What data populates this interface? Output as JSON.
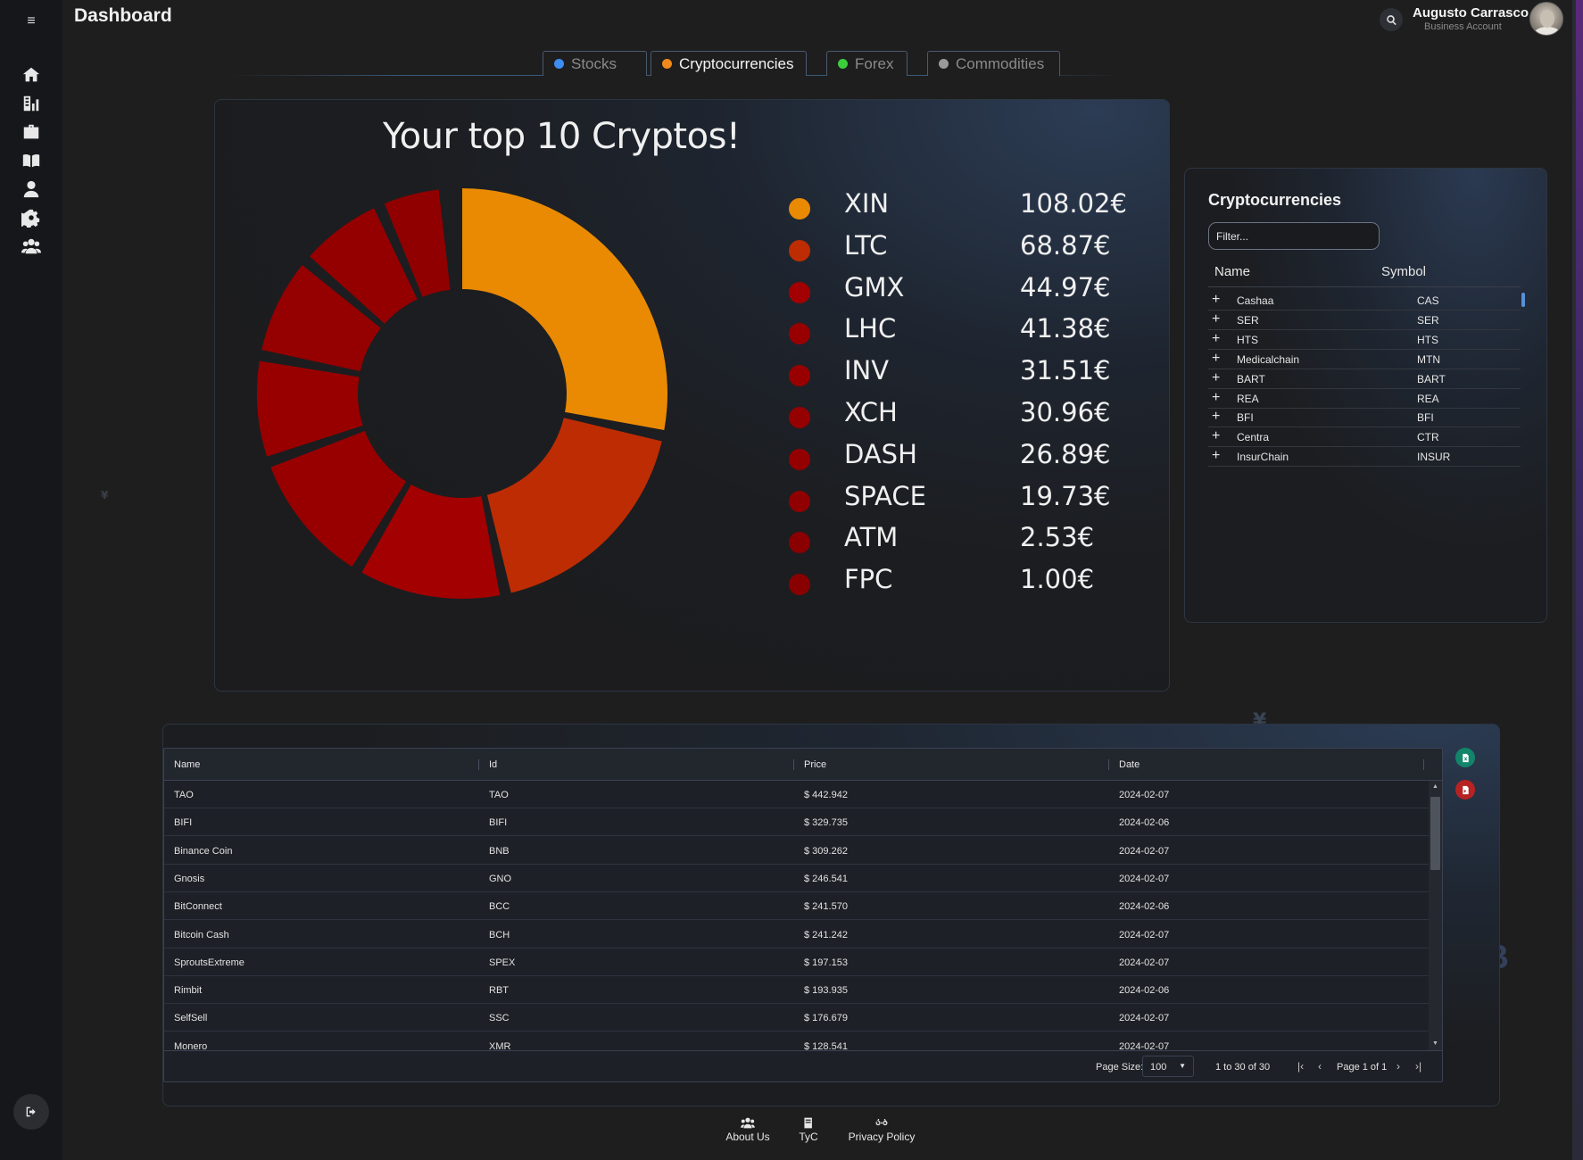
{
  "header": {
    "title": "Dashboard",
    "user_name": "Augusto Carrasco",
    "user_role": "Business Account"
  },
  "tabs": [
    {
      "label": "Stocks",
      "color": "#3d8ef0",
      "active": false
    },
    {
      "label": "Cryptocurrencies",
      "color": "#f08a1a",
      "active": true
    },
    {
      "label": "Forex",
      "color": "#3ccc3c",
      "active": false
    },
    {
      "label": "Commodities",
      "color": "#9a9a9a",
      "active": false
    }
  ],
  "sidebar": {
    "icons": [
      "home-icon",
      "chart-building-icon",
      "briefcase-icon",
      "book-icon",
      "user-icon",
      "gear-icon",
      "users-icon"
    ]
  },
  "chart_data": {
    "type": "pie",
    "style": "donut",
    "title": "Your top 10 Cryptos!",
    "categories": [
      "XIN",
      "LTC",
      "GMX",
      "LHC",
      "INV",
      "XCH",
      "DASH",
      "SPACE",
      "ATM",
      "FPC"
    ],
    "values": [
      108.02,
      68.87,
      44.97,
      41.38,
      31.51,
      30.96,
      26.89,
      19.73,
      2.53,
      1.0
    ],
    "value_labels": [
      "108.02€",
      "68.87€",
      "44.97€",
      "41.38€",
      "31.51€",
      "30.96€",
      "26.89€",
      "19.73€",
      "2.53€",
      "1.00€"
    ],
    "colors": [
      "#e98a02",
      "#be2c03",
      "#a30101",
      "#980000",
      "#980000",
      "#950000",
      "#940000",
      "#900000",
      "#8a0000",
      "#880000"
    ],
    "legend_position": "right"
  },
  "crypto_list": {
    "title": "Cryptocurrencies",
    "filter_placeholder": "Filter...",
    "columns": [
      "Name",
      "Symbol"
    ],
    "rows": [
      {
        "name": "Cashaa",
        "symbol": "CAS"
      },
      {
        "name": "SER",
        "symbol": "SER"
      },
      {
        "name": "HTS",
        "symbol": "HTS"
      },
      {
        "name": "Medicalchain",
        "symbol": "MTN"
      },
      {
        "name": "BART",
        "symbol": "BART"
      },
      {
        "name": "REA",
        "symbol": "REA"
      },
      {
        "name": "BFI",
        "symbol": "BFI"
      },
      {
        "name": "Centra",
        "symbol": "CTR"
      },
      {
        "name": "InsurChain",
        "symbol": "INSUR"
      }
    ]
  },
  "price_table": {
    "columns": [
      "Name",
      "Id",
      "Price",
      "Date"
    ],
    "rows": [
      {
        "name": "TAO",
        "id": "TAO",
        "price": "$ 442.942",
        "date": "2024-02-07"
      },
      {
        "name": "BIFI",
        "id": "BIFI",
        "price": "$ 329.735",
        "date": "2024-02-06"
      },
      {
        "name": "Binance Coin",
        "id": "BNB",
        "price": "$ 309.262",
        "date": "2024-02-07"
      },
      {
        "name": "Gnosis",
        "id": "GNO",
        "price": "$ 246.541",
        "date": "2024-02-07"
      },
      {
        "name": "BitConnect",
        "id": "BCC",
        "price": "$ 241.570",
        "date": "2024-02-06"
      },
      {
        "name": "Bitcoin Cash",
        "id": "BCH",
        "price": "$ 241.242",
        "date": "2024-02-07"
      },
      {
        "name": "SproutsExtreme",
        "id": "SPEX",
        "price": "$ 197.153",
        "date": "2024-02-07"
      },
      {
        "name": "Rimbit",
        "id": "RBT",
        "price": "$ 193.935",
        "date": "2024-02-06"
      },
      {
        "name": "SelfSell",
        "id": "SSC",
        "price": "$ 176.679",
        "date": "2024-02-07"
      },
      {
        "name": "Monero",
        "id": "XMR",
        "price": "$ 128.541",
        "date": "2024-02-07"
      }
    ],
    "pager": {
      "page_size_label": "Page Size:",
      "page_size": "100",
      "count": "1 to 30 of 30",
      "page": "Page 1 of 1"
    }
  },
  "footer": {
    "links": [
      {
        "label": "About Us",
        "icon": "users-icon"
      },
      {
        "label": "TyC",
        "icon": "book-icon"
      },
      {
        "label": "Privacy Policy",
        "icon": "glasses-icon"
      }
    ]
  }
}
